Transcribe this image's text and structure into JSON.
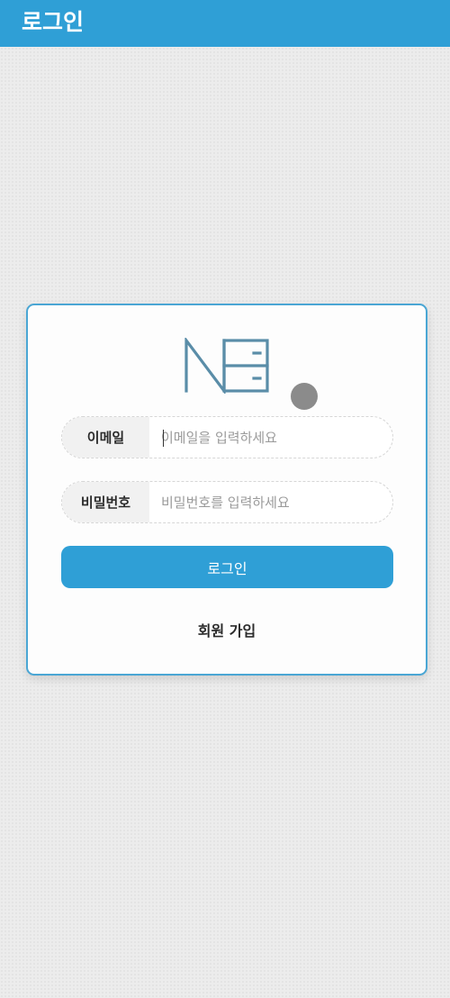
{
  "app_bar": {
    "title": "로그인",
    "color": "#2f9fd6"
  },
  "login_form": {
    "logo_icon": "nb-logo-icon",
    "email": {
      "label": "이메일",
      "placeholder": "이메일을 입력하세요",
      "value": ""
    },
    "password": {
      "label": "비밀번호",
      "placeholder": "비밀번호를 입력하세요",
      "value": ""
    },
    "submit_label": "로그인",
    "signup_label": "회원 가입",
    "accent_color": "#2f9fd6",
    "border_color": "#4aa6d4"
  }
}
